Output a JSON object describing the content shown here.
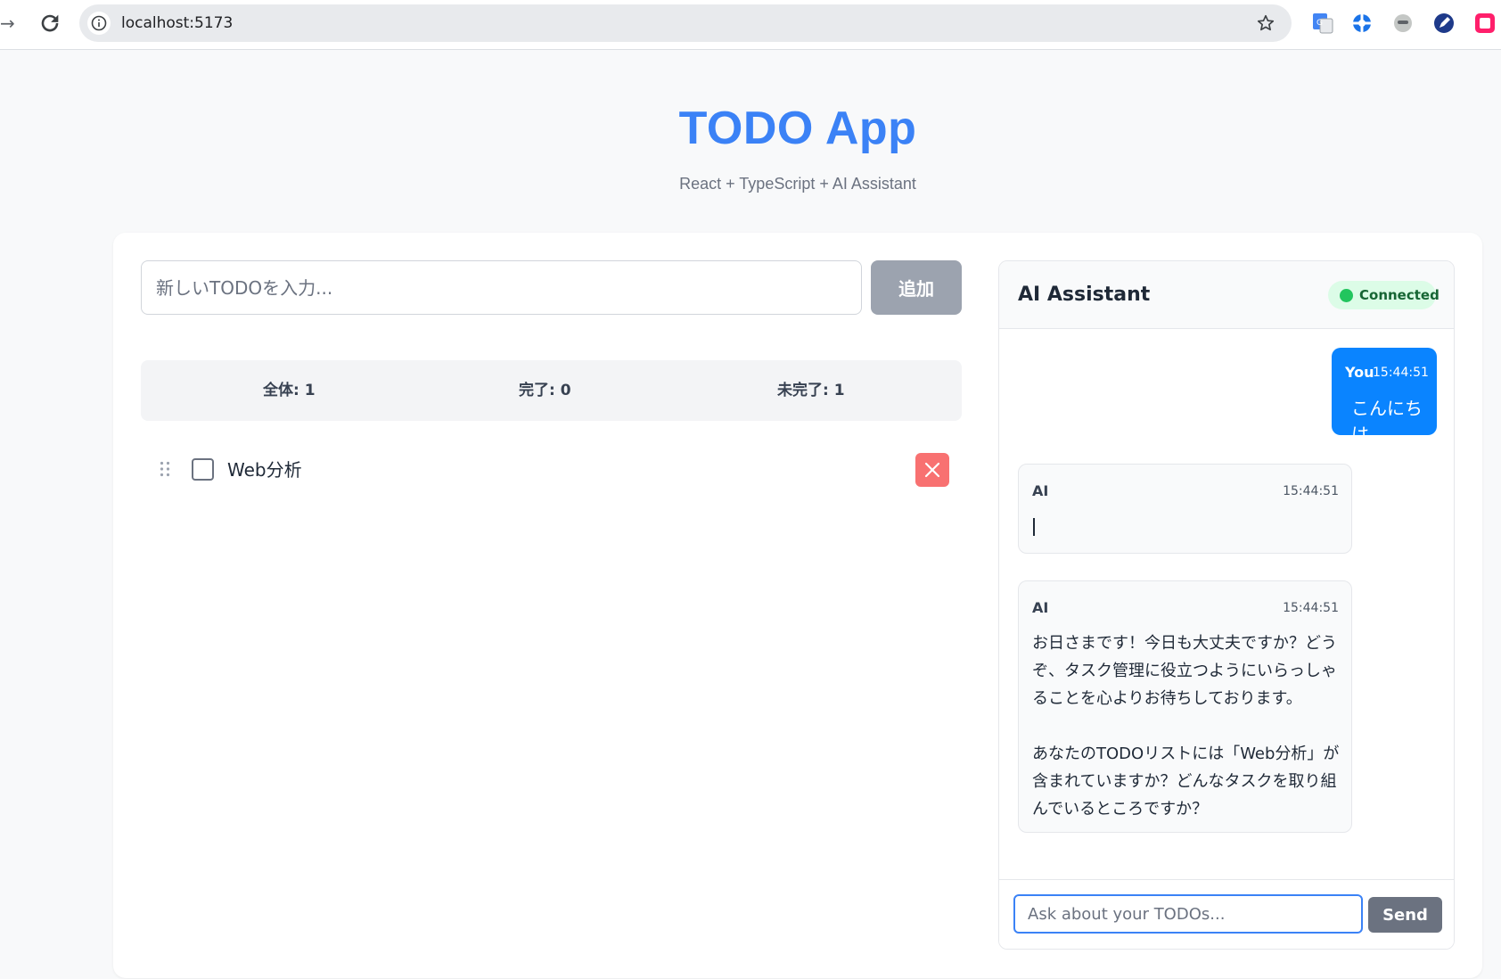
{
  "browser": {
    "url": "localhost:5173"
  },
  "header": {
    "title": "TODO App",
    "subtitle": "React + TypeScript + AI Assistant"
  },
  "todo_form": {
    "placeholder": "新しいTODOを入力...",
    "add_label": "追加"
  },
  "stats": {
    "total": "全体: 1",
    "completed": "完了: 0",
    "remaining": "未完了: 1"
  },
  "todos": [
    {
      "text": "Web分析",
      "completed": false
    }
  ],
  "chat": {
    "title": "AI Assistant",
    "status": "Connected",
    "messages": [
      {
        "sender": "You",
        "time": "15:44:51",
        "text": "こんにちは"
      },
      {
        "sender": "AI",
        "time": "15:44:51",
        "text": ""
      },
      {
        "sender": "AI",
        "time": "15:44:51",
        "text": "お日さまです！今日も大丈夫ですか？どうぞ、タスク管理に役立つようにいらっしゃることを心よりお待ちしております。\n\nあなたのTODOリストには「Web分析」が含まれていますか？どんなタスクを取り組んでいるところですか？"
      }
    ],
    "input_placeholder": "Ask about your TODOs...",
    "send_label": "Send"
  },
  "colors": {
    "accent": "#3b82f6",
    "user_bubble": "#0a84ff",
    "delete": "#f87171",
    "status_ok": "#22c55e"
  }
}
